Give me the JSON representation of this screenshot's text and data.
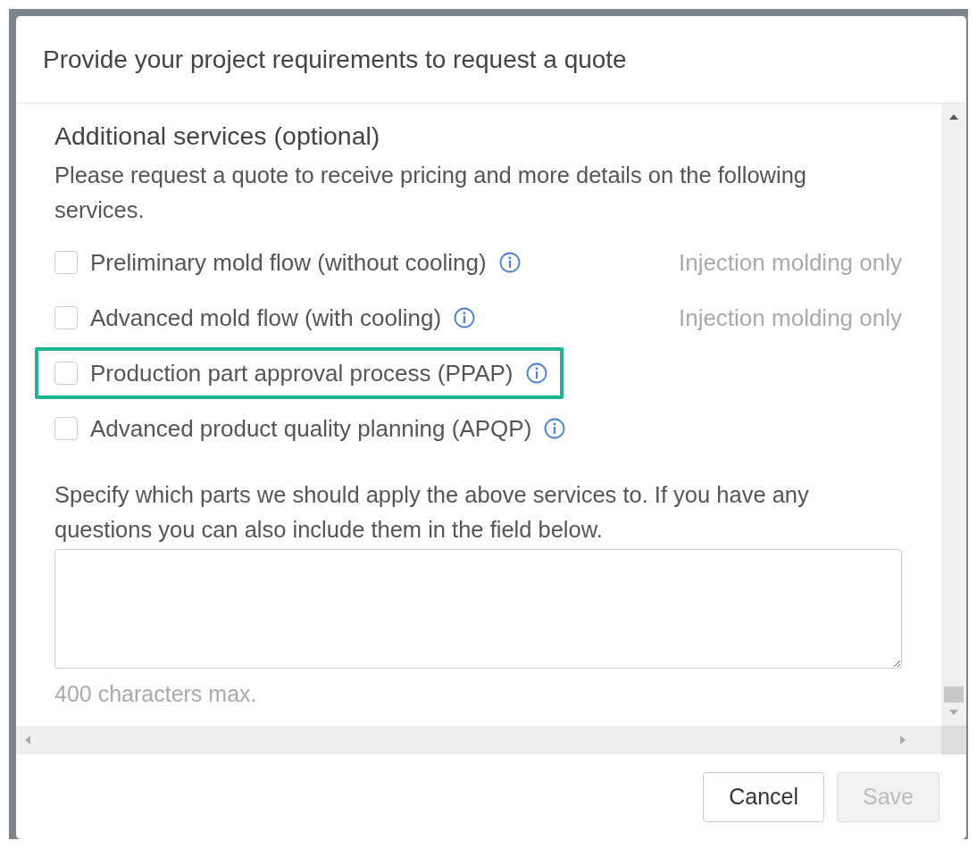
{
  "dialog": {
    "title": "Provide your project requirements to request a quote"
  },
  "section": {
    "heading": "Additional services (optional)",
    "description": "Please request a quote to receive pricing and more details on the following services."
  },
  "options": [
    {
      "label": "Preliminary mold flow (without cooling)",
      "checked": false,
      "highlighted": false,
      "note": "Injection molding only"
    },
    {
      "label": "Advanced mold flow (with cooling)",
      "checked": false,
      "highlighted": false,
      "note": "Injection molding only"
    },
    {
      "label": "Production part approval process (PPAP)",
      "checked": false,
      "highlighted": true
    },
    {
      "label": "Advanced product quality planning (APQP)",
      "checked": false,
      "highlighted": false
    }
  ],
  "notes_field": {
    "instructions": "Specify which parts we should apply the above services to. If you have any questions you can also include them in the field below.",
    "limit": "400 characters max."
  },
  "buttons": [
    {
      "label": "Cancel",
      "disabled": false
    },
    {
      "label": "Save",
      "disabled": true
    }
  ]
}
